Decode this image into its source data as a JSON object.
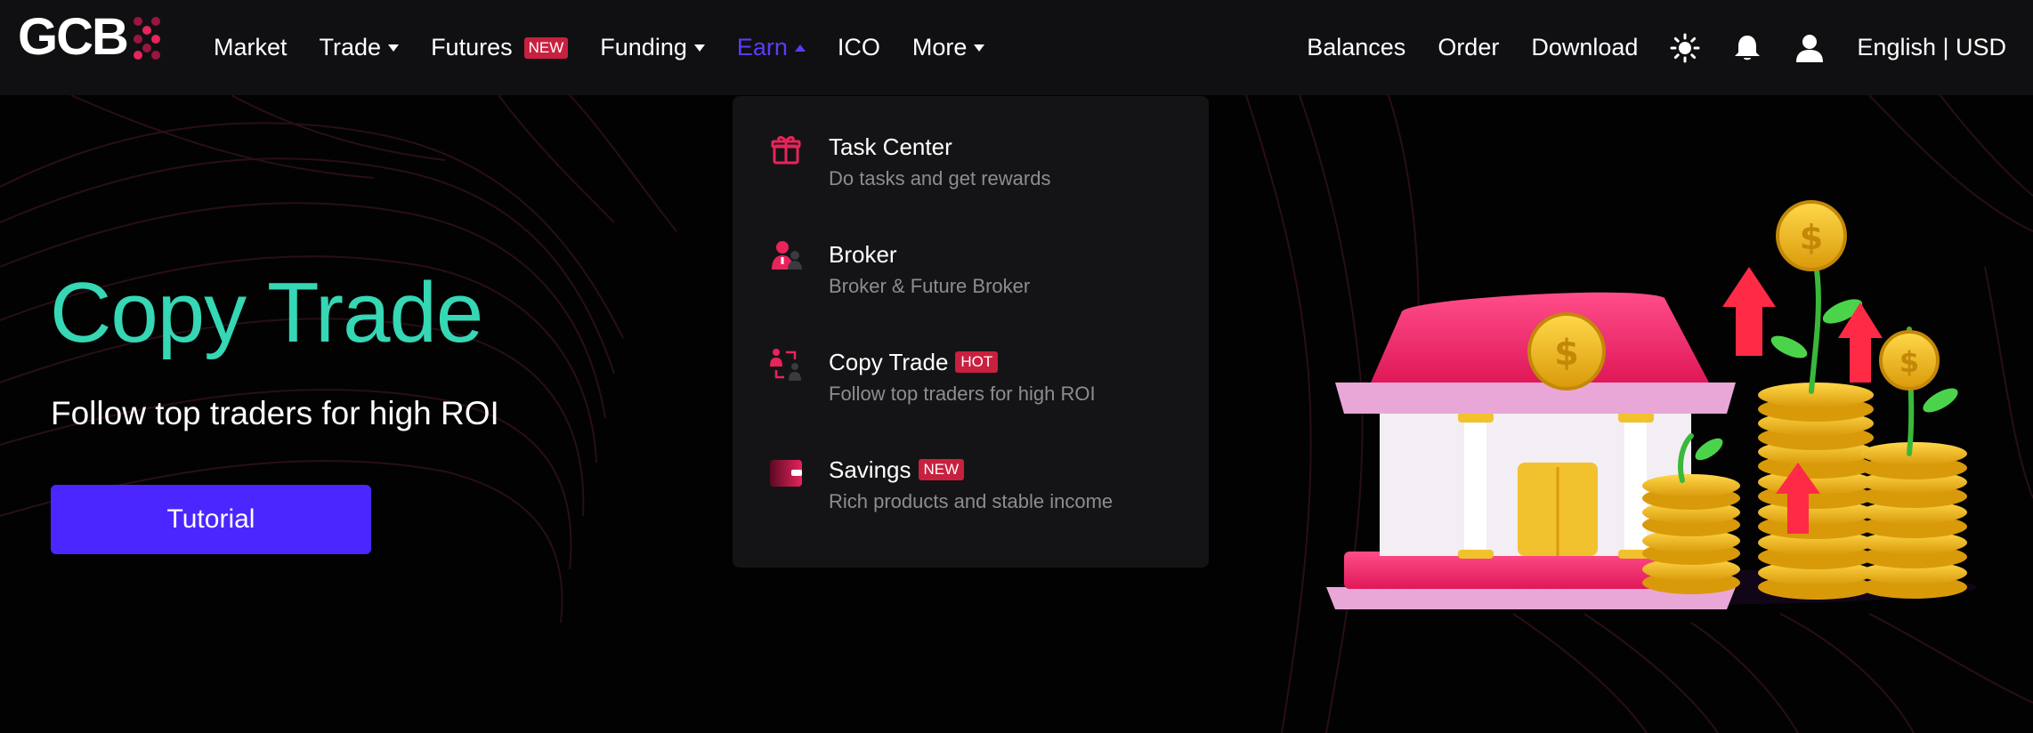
{
  "brand": {
    "logo_text": "GCB"
  },
  "nav": {
    "items": [
      {
        "label": "Market",
        "has_caret": false
      },
      {
        "label": "Trade",
        "has_caret": true
      },
      {
        "label": "Futures",
        "badge": "NEW"
      },
      {
        "label": "Funding",
        "has_caret": true
      },
      {
        "label": "Earn",
        "has_caret": true,
        "active": true
      },
      {
        "label": "ICO"
      },
      {
        "label": "More",
        "has_caret": true
      }
    ],
    "right": {
      "balances": "Balances",
      "order": "Order",
      "download": "Download",
      "language": "English | USD"
    },
    "icons": [
      "sun-icon",
      "bell-icon",
      "user-icon"
    ]
  },
  "dropdown": {
    "items": [
      {
        "title": "Task Center",
        "desc": "Do tasks and get rewards",
        "icon": "gift-icon"
      },
      {
        "title": "Broker",
        "desc": "Broker & Future Broker",
        "icon": "broker-icon"
      },
      {
        "title": "Copy Trade",
        "badge": "HOT",
        "desc": "Follow top traders for high ROI",
        "icon": "copy-trade-icon"
      },
      {
        "title": "Savings",
        "badge": "NEW",
        "desc": "Rich products and stable income",
        "icon": "savings-icon"
      }
    ]
  },
  "hero": {
    "title": "Copy Trade",
    "subtitle": "Follow top traders for high ROI",
    "button": "Tutorial"
  },
  "colors": {
    "accent": "#4b26ff",
    "active_nav": "#5b3bff",
    "hero_title": "#35d7b4",
    "badge": "#c8203f",
    "brand_pink": "#e8245b"
  }
}
